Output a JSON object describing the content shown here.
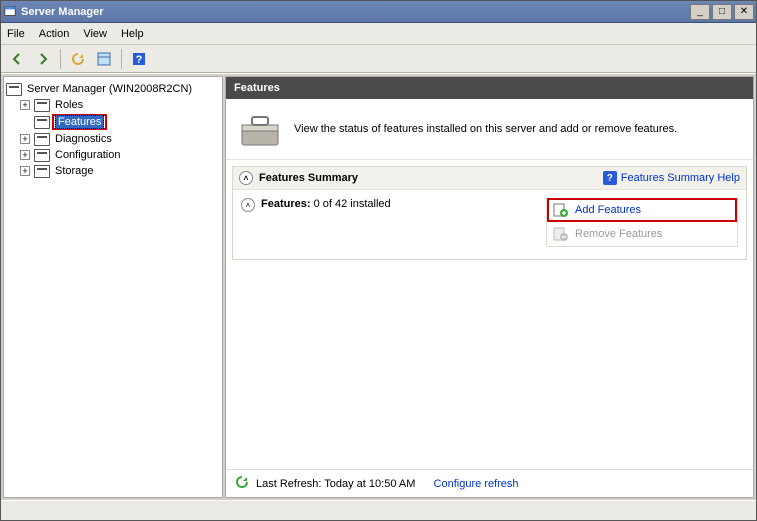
{
  "title": "Server Manager",
  "menus": {
    "file": "File",
    "action": "Action",
    "view": "View",
    "help": "Help"
  },
  "tree": {
    "root": "Server Manager (WIN2008R2CN)",
    "roles": "Roles",
    "features": "Features",
    "diagnostics": "Diagnostics",
    "configuration": "Configuration",
    "storage": "Storage"
  },
  "pane": {
    "header": "Features",
    "banner_text": "View the status of features installed on this server and add or remove features.",
    "summary_title": "Features Summary",
    "summary_help": "Features Summary Help",
    "features_label": "Features:",
    "features_status": "0 of 42 installed",
    "add_features": "Add Features",
    "remove_features": "Remove Features"
  },
  "status": {
    "last_refresh": "Last Refresh: Today at 10:50 AM",
    "configure": "Configure refresh"
  }
}
